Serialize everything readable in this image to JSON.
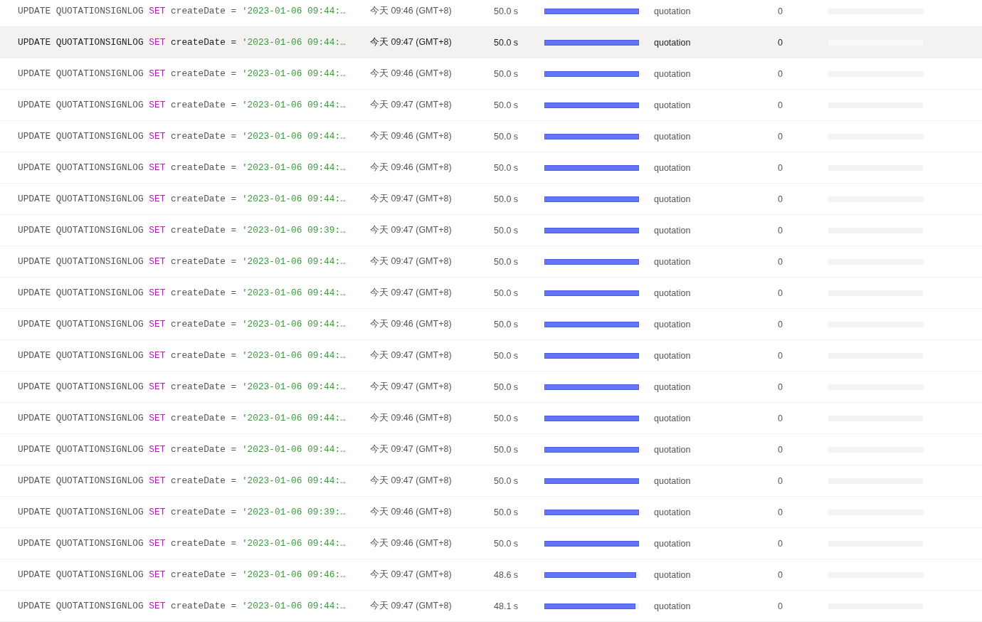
{
  "rows": [
    {
      "sql": {
        "statement": "UPDATE QUOTATIONSIGNLOG",
        "keyword": "SET",
        "assignment": "createDate =",
        "literal": "'2023-01-06 09:44:…"
      },
      "time": "今天 09:46 (GMT+8)",
      "duration": "50.0 s",
      "level": 1,
      "database": "quotation",
      "count": "0",
      "selected": false
    },
    {
      "sql": {
        "statement": "UPDATE QUOTATIONSIGNLOG",
        "keyword": "SET",
        "assignment": "createDate =",
        "literal": "'2023-01-06 09:44:…"
      },
      "time": "今天 09:47 (GMT+8)",
      "duration": "50.0 s",
      "level": 1,
      "database": "quotation",
      "count": "0",
      "selected": true
    },
    {
      "sql": {
        "statement": "UPDATE QUOTATIONSIGNLOG",
        "keyword": "SET",
        "assignment": "createDate =",
        "literal": "'2023-01-06 09:44:…"
      },
      "time": "今天 09:46 (GMT+8)",
      "duration": "50.0 s",
      "level": 1,
      "database": "quotation",
      "count": "0",
      "selected": false
    },
    {
      "sql": {
        "statement": "UPDATE QUOTATIONSIGNLOG",
        "keyword": "SET",
        "assignment": "createDate =",
        "literal": "'2023-01-06 09:44:…"
      },
      "time": "今天 09:47 (GMT+8)",
      "duration": "50.0 s",
      "level": 1,
      "database": "quotation",
      "count": "0",
      "selected": false
    },
    {
      "sql": {
        "statement": "UPDATE QUOTATIONSIGNLOG",
        "keyword": "SET",
        "assignment": "createDate =",
        "literal": "'2023-01-06 09:44:…"
      },
      "time": "今天 09:46 (GMT+8)",
      "duration": "50.0 s",
      "level": 1,
      "database": "quotation",
      "count": "0",
      "selected": false
    },
    {
      "sql": {
        "statement": "UPDATE QUOTATIONSIGNLOG",
        "keyword": "SET",
        "assignment": "createDate =",
        "literal": "'2023-01-06 09:44:…"
      },
      "time": "今天 09:46 (GMT+8)",
      "duration": "50.0 s",
      "level": 1,
      "database": "quotation",
      "count": "0",
      "selected": false
    },
    {
      "sql": {
        "statement": "UPDATE QUOTATIONSIGNLOG",
        "keyword": "SET",
        "assignment": "createDate =",
        "literal": "'2023-01-06 09:44:…"
      },
      "time": "今天 09:47 (GMT+8)",
      "duration": "50.0 s",
      "level": 1,
      "database": "quotation",
      "count": "0",
      "selected": false
    },
    {
      "sql": {
        "statement": "UPDATE QUOTATIONSIGNLOG",
        "keyword": "SET",
        "assignment": "createDate =",
        "literal": "'2023-01-06 09:39:…"
      },
      "time": "今天 09:47 (GMT+8)",
      "duration": "50.0 s",
      "level": 1,
      "database": "quotation",
      "count": "0",
      "selected": false
    },
    {
      "sql": {
        "statement": "UPDATE QUOTATIONSIGNLOG",
        "keyword": "SET",
        "assignment": "createDate =",
        "literal": "'2023-01-06 09:44:…"
      },
      "time": "今天 09:47 (GMT+8)",
      "duration": "50.0 s",
      "level": 1,
      "database": "quotation",
      "count": "0",
      "selected": false
    },
    {
      "sql": {
        "statement": "UPDATE QUOTATIONSIGNLOG",
        "keyword": "SET",
        "assignment": "createDate =",
        "literal": "'2023-01-06 09:44:…"
      },
      "time": "今天 09:47 (GMT+8)",
      "duration": "50.0 s",
      "level": 1,
      "database": "quotation",
      "count": "0",
      "selected": false
    },
    {
      "sql": {
        "statement": "UPDATE QUOTATIONSIGNLOG",
        "keyword": "SET",
        "assignment": "createDate =",
        "literal": "'2023-01-06 09:44:…"
      },
      "time": "今天 09:46 (GMT+8)",
      "duration": "50.0 s",
      "level": 1,
      "database": "quotation",
      "count": "0",
      "selected": false
    },
    {
      "sql": {
        "statement": "UPDATE QUOTATIONSIGNLOG",
        "keyword": "SET",
        "assignment": "createDate =",
        "literal": "'2023-01-06 09:44:…"
      },
      "time": "今天 09:47 (GMT+8)",
      "duration": "50.0 s",
      "level": 1,
      "database": "quotation",
      "count": "0",
      "selected": false
    },
    {
      "sql": {
        "statement": "UPDATE QUOTATIONSIGNLOG",
        "keyword": "SET",
        "assignment": "createDate =",
        "literal": "'2023-01-06 09:44:…"
      },
      "time": "今天 09:47 (GMT+8)",
      "duration": "50.0 s",
      "level": 1,
      "database": "quotation",
      "count": "0",
      "selected": false
    },
    {
      "sql": {
        "statement": "UPDATE QUOTATIONSIGNLOG",
        "keyword": "SET",
        "assignment": "createDate =",
        "literal": "'2023-01-06 09:44:…"
      },
      "time": "今天 09:46 (GMT+8)",
      "duration": "50.0 s",
      "level": 1,
      "database": "quotation",
      "count": "0",
      "selected": false
    },
    {
      "sql": {
        "statement": "UPDATE QUOTATIONSIGNLOG",
        "keyword": "SET",
        "assignment": "createDate =",
        "literal": "'2023-01-06 09:44:…"
      },
      "time": "今天 09:47 (GMT+8)",
      "duration": "50.0 s",
      "level": 1,
      "database": "quotation",
      "count": "0",
      "selected": false
    },
    {
      "sql": {
        "statement": "UPDATE QUOTATIONSIGNLOG",
        "keyword": "SET",
        "assignment": "createDate =",
        "literal": "'2023-01-06 09:44:…"
      },
      "time": "今天 09:47 (GMT+8)",
      "duration": "50.0 s",
      "level": 1,
      "database": "quotation",
      "count": "0",
      "selected": false
    },
    {
      "sql": {
        "statement": "UPDATE QUOTATIONSIGNLOG",
        "keyword": "SET",
        "assignment": "createDate =",
        "literal": "'2023-01-06 09:39:…"
      },
      "time": "今天 09:46 (GMT+8)",
      "duration": "50.0 s",
      "level": 1,
      "database": "quotation",
      "count": "0",
      "selected": false
    },
    {
      "sql": {
        "statement": "UPDATE QUOTATIONSIGNLOG",
        "keyword": "SET",
        "assignment": "createDate =",
        "literal": "'2023-01-06 09:44:…"
      },
      "time": "今天 09:46 (GMT+8)",
      "duration": "50.0 s",
      "level": 1,
      "database": "quotation",
      "count": "0",
      "selected": false
    },
    {
      "sql": {
        "statement": "UPDATE QUOTATIONSIGNLOG",
        "keyword": "SET",
        "assignment": "createDate =",
        "literal": "'2023-01-06 09:46:…"
      },
      "time": "今天 09:47 (GMT+8)",
      "duration": "48.6 s",
      "level": 0.97,
      "database": "quotation",
      "count": "0",
      "selected": false
    },
    {
      "sql": {
        "statement": "UPDATE QUOTATIONSIGNLOG",
        "keyword": "SET",
        "assignment": "createDate =",
        "literal": "'2023-01-06 09:44:…"
      },
      "time": "今天 09:47 (GMT+8)",
      "duration": "48.1 s",
      "level": 0.96,
      "database": "quotation",
      "count": "0",
      "selected": false
    }
  ]
}
